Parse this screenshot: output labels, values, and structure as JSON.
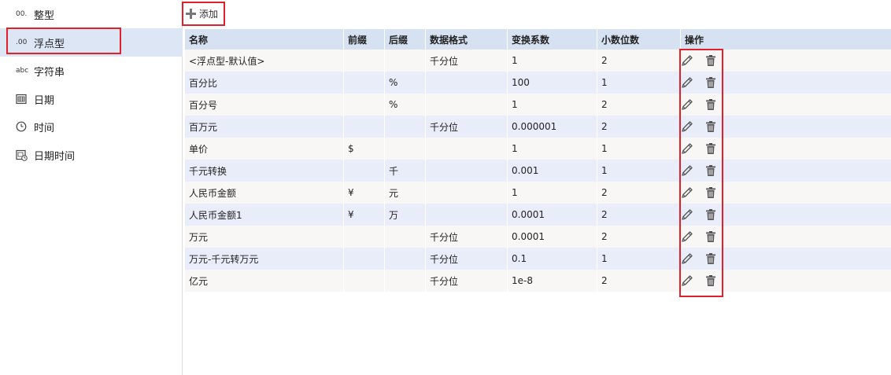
{
  "sidebar": {
    "items": [
      {
        "icon_text": "00.",
        "label": "整型",
        "icon": "integer-icon",
        "active": false
      },
      {
        "icon_text": ".00",
        "label": "浮点型",
        "icon": "float-icon",
        "active": true
      },
      {
        "icon_text": "abc",
        "label": "字符串",
        "icon": "string-icon",
        "active": false
      },
      {
        "icon_text": "",
        "label": "日期",
        "icon": "calendar-icon",
        "active": false
      },
      {
        "icon_text": "",
        "label": "时间",
        "icon": "clock-icon",
        "active": false
      },
      {
        "icon_text": "",
        "label": "日期时间",
        "icon": "datetime-icon",
        "active": false
      }
    ]
  },
  "toolbar": {
    "add_label": "添加"
  },
  "table": {
    "headers": [
      "名称",
      "前缀",
      "后缀",
      "数据格式",
      "变换系数",
      "小数位数",
      "操作"
    ],
    "rows": [
      [
        "<浮点型-默认值>",
        "",
        "",
        "千分位",
        "1",
        "2"
      ],
      [
        "百分比",
        "",
        "%",
        "",
        "100",
        "1"
      ],
      [
        "百分号",
        "",
        "%",
        "",
        "1",
        "2"
      ],
      [
        "百万元",
        "",
        "",
        "千分位",
        "0.000001",
        "2"
      ],
      [
        "单价",
        "$",
        "",
        "",
        "1",
        "1"
      ],
      [
        "千元转换",
        "",
        "千",
        "",
        "0.001",
        "1"
      ],
      [
        "人民币金额",
        "¥",
        "元",
        "",
        "1",
        "2"
      ],
      [
        "人民币金额1",
        "¥",
        "万",
        "",
        "0.0001",
        "2"
      ],
      [
        "万元",
        "",
        "",
        "千分位",
        "0.0001",
        "2"
      ],
      [
        "万元-千元转万元",
        "",
        "",
        "千分位",
        "0.1",
        "1"
      ],
      [
        "亿元",
        "",
        "",
        "千分位",
        "1e-8",
        "2"
      ]
    ]
  },
  "colors": {
    "highlight": "#e0202a",
    "header_bg": "#d6e1f1",
    "row_odd": "#f8f7f5",
    "row_even": "#e8edf9",
    "sidebar_active": "#dce6f5"
  }
}
